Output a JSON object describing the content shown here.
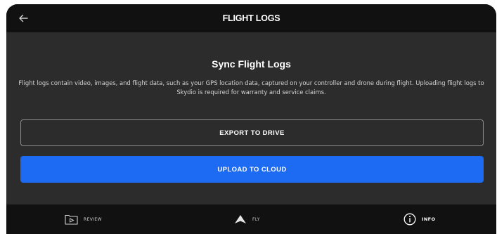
{
  "header": {
    "title": "FLIGHT LOGS",
    "back_icon": "arrow-left-icon"
  },
  "main": {
    "heading": "Sync Flight Logs",
    "description": "Flight logs contain video, images, and flight data, such as your GPS location data, captured on your controller and drone during flight. Uploading flight logs to Skydio is required for warranty and service claims.",
    "export_label": "EXPORT TO DRIVE",
    "upload_label": "UPLOAD TO CLOUD"
  },
  "nav": {
    "review": {
      "label": "REVIEW",
      "icon": "play-folder-icon"
    },
    "fly": {
      "label": "FLY",
      "icon": "arrow-up-icon"
    },
    "info": {
      "label": "INFO",
      "icon": "info-circle-icon"
    }
  },
  "colors": {
    "primary": "#1d6bf2",
    "bar_bg": "#111111",
    "panel_bg": "#2c2c2c"
  }
}
